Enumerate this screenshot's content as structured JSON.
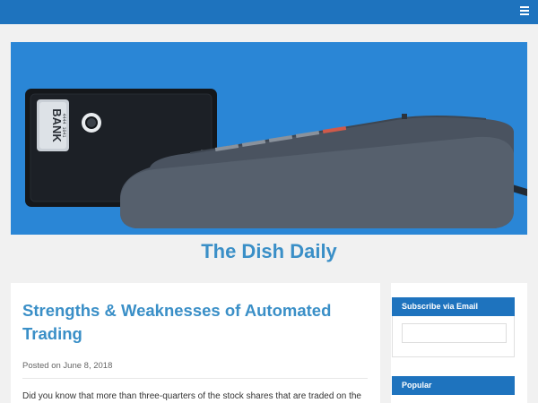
{
  "site": {
    "title": "The Dish Daily",
    "hero_card_text": "BANK",
    "hero_card_number": "4444 1041",
    "hero_card_label": "ICC"
  },
  "post": {
    "title": "Strengths & Weaknesses of Automated Trading",
    "meta": "Posted on June 8, 2018",
    "excerpt": "Did you know that more than three-quarters of the stock shares that are traded on the"
  },
  "sidebar": {
    "subscribe_title": "Subscribe via Email",
    "subscribe_placeholder": "",
    "popular_title": "Popular"
  },
  "icons": {
    "menu": "hamburger-menu-icon"
  },
  "colors": {
    "accent": "#1e73be",
    "title": "#3a8fc7",
    "hero_bg": "#2a86d6"
  }
}
